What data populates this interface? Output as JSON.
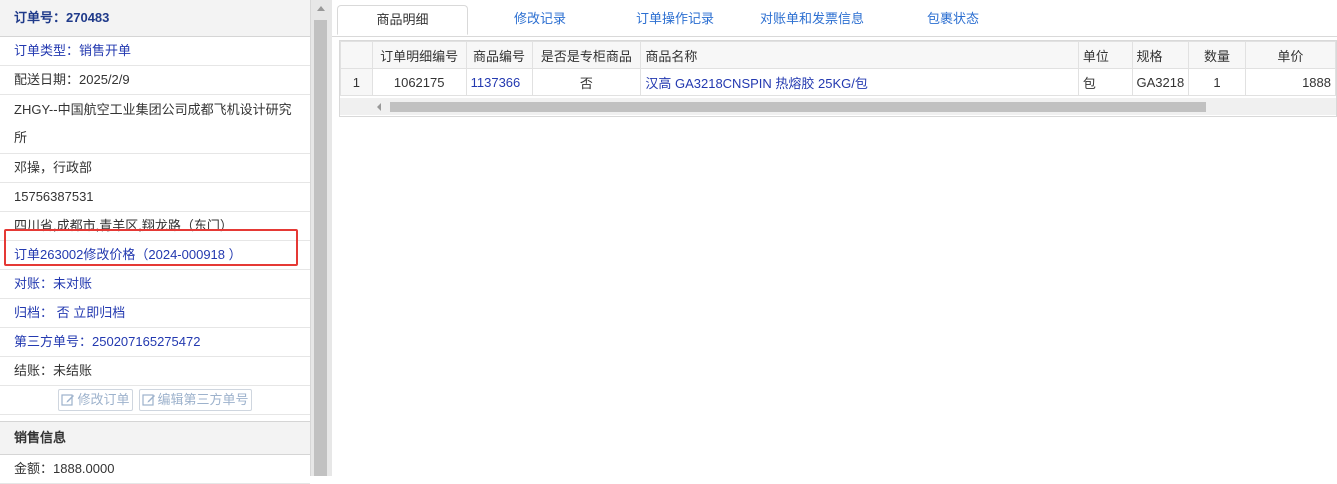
{
  "order": {
    "title": "订单号：270483",
    "type": "订单类型：销售开单",
    "delivery_date": "配送日期：2025/2/9",
    "customer_line1": "ZHGY--中国航空工业集团公司成都飞机设计研究",
    "customer_line2": "所",
    "contact": "邓操，行政部",
    "phone": "15756387531",
    "address": "四川省,成都市,青羊区,翔龙路（东门）",
    "price_change": "订单263002修改价格（2024-000918 ）",
    "reconcile": "对账：未对账",
    "archive": "归档： 否 立即归档",
    "third_party": "第三方单号：250207165275472",
    "settle": "结账：未结账",
    "edit_order_btn": "修改订单",
    "edit_third_btn": "编辑第三方单号"
  },
  "sales": {
    "title": "销售信息",
    "amount": "金额：1888.0000"
  },
  "tabs": [
    "商品明细",
    "修改记录",
    "订单操作记录",
    "对账单和发票信息",
    "包裹状态"
  ],
  "table": {
    "headers": [
      "",
      "订单明细编号",
      "商品编号",
      "是否是专柜商品",
      "商品名称",
      "单位",
      "规格",
      "数量",
      "单价"
    ],
    "rows": [
      [
        "1",
        "1062175",
        "1137366",
        "否",
        "汉高 GA3218CNSPIN 热熔胶 25KG/包",
        "包",
        "GA3218",
        "1",
        "1888"
      ]
    ]
  },
  "colors": {
    "link": "#2339b0",
    "highlight": "#e53935",
    "tab_link": "#2c6fd1"
  },
  "icons": [
    "edit-icon"
  ]
}
